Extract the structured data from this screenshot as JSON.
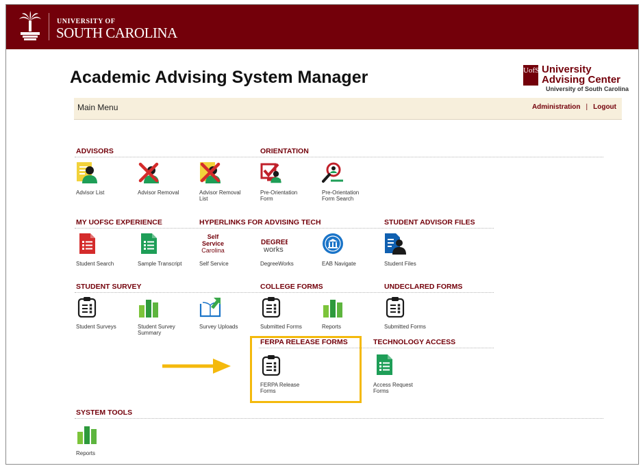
{
  "banner": {
    "university_of": "UNIVERSITY OF",
    "university_name": "SOUTH CAROLINA"
  },
  "page_title": "Academic Advising System Manager",
  "center_logo": {
    "box_text": "UofSC",
    "line1": "University",
    "line2": "Advising Center",
    "line3": "University of South Carolina"
  },
  "menu": {
    "title": "Main Menu",
    "admin_link": "Administration",
    "separator": "|",
    "logout_link": "Logout"
  },
  "sections": {
    "advisors": {
      "title": "ADVISORS",
      "items": [
        "Advisor List",
        "Advisor Removal",
        "Advisor Removal\nList"
      ]
    },
    "orientation": {
      "title": "ORIENTATION",
      "items": [
        "Pre-Orientation\nForm",
        "Pre-Orientation\nForm Search"
      ]
    },
    "my_uofsc": {
      "title": "MY UOFSC EXPERIENCE",
      "items": [
        "Student Search",
        "Sample Transcript"
      ]
    },
    "hyperlinks": {
      "title": "HYPERLINKS FOR ADVISING TECH",
      "items": [
        "Self Service",
        "DegreeWorks",
        "EAB Navigate"
      ]
    },
    "student_files": {
      "title": "STUDENT ADVISOR FILES",
      "items": [
        "Student Files"
      ]
    },
    "student_survey": {
      "title": "STUDENT SURVEY",
      "items": [
        "Student Surveys",
        "Student Survey\nSummary",
        "Survey Uploads"
      ]
    },
    "college_forms": {
      "title": "COLLEGE FORMS",
      "items": [
        "Submitted Forms",
        "Reports"
      ]
    },
    "undeclared_forms": {
      "title": "UNDECLARED FORMS",
      "items": [
        "Submitted Forms"
      ]
    },
    "ferpa": {
      "title": "FERPA RELEASE FORMS",
      "items": [
        "FERPA Release\nForms"
      ]
    },
    "technology": {
      "title": "TECHNOLOGY ACCESS",
      "items": [
        "Access Request\nForms"
      ]
    },
    "system_tools": {
      "title": "SYSTEM TOOLS",
      "items": [
        "Reports"
      ]
    }
  },
  "icon_text": {
    "self_service": {
      "l1": "Self",
      "l2": "Service",
      "l3": "Carolina"
    },
    "degreeworks": {
      "l1": "DEGREE",
      "l2": "works"
    }
  },
  "colors": {
    "garnet": "#73000a",
    "highlight": "#f4b90c",
    "green": "#1e9e57",
    "red": "#d42b2b",
    "yellow": "#f2d23b",
    "blue": "#1060b0"
  },
  "icons": [
    "crest-icon",
    "user-list-icon",
    "user-remove-icon",
    "user-remove-list-icon",
    "checkbox-form-icon",
    "search-user-icon",
    "red-list-icon",
    "green-list-icon",
    "self-service-logo",
    "degreeworks-logo",
    "eab-navigate-icon",
    "student-files-icon",
    "clipboard-icon",
    "bar-chart-icon",
    "upload-book-icon",
    "arrow-icon"
  ]
}
